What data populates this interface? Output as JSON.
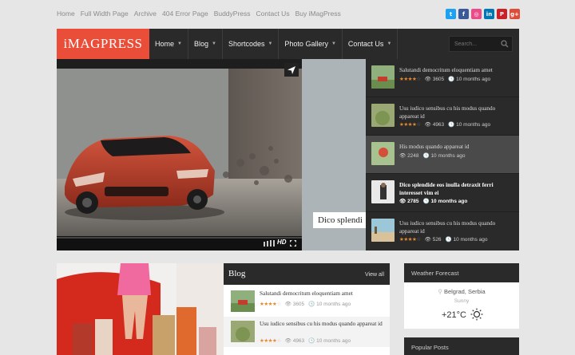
{
  "top_links": [
    "Home",
    "Full Width Page",
    "Archive",
    "404 Error Page",
    "BuddyPress",
    "Contact Us",
    "Buy iMagPress"
  ],
  "social": [
    {
      "name": "twitter",
      "glyph": "t",
      "color": "#1da1f2"
    },
    {
      "name": "facebook",
      "glyph": "f",
      "color": "#3b5998"
    },
    {
      "name": "dribbble",
      "glyph": "◎",
      "color": "#ea4c89"
    },
    {
      "name": "linkedin",
      "glyph": "in",
      "color": "#0077b5"
    },
    {
      "name": "pinterest",
      "glyph": "P",
      "color": "#cb2027"
    },
    {
      "name": "google-plus",
      "glyph": "g+",
      "color": "#dd4b39"
    }
  ],
  "brand": {
    "logo": "iMAGPRESS",
    "accent": "#ea4d38"
  },
  "nav": [
    {
      "label": "Home",
      "dropdown": true
    },
    {
      "label": "Blog",
      "dropdown": true
    },
    {
      "label": "Shortcodes",
      "dropdown": true
    },
    {
      "label": "Photo Gallery",
      "dropdown": true
    },
    {
      "label": "Contact Us",
      "dropdown": true
    }
  ],
  "search": {
    "placeholder": "Search..."
  },
  "slider": {
    "caption": "Dico splendi",
    "hd_label": "HD"
  },
  "slider_list": [
    {
      "title": "Salutandi democritum eloquentiam amet",
      "rating": 3.5,
      "views": "3605",
      "time": "10 months ago"
    },
    {
      "title": "Usu iudico sensibus cu his modus quando appareat id",
      "rating": 3.5,
      "views": "4963",
      "time": "10 months ago"
    },
    {
      "title": "His modus quando appareat id",
      "rating": 0,
      "views": "2248",
      "time": "10 months ago"
    },
    {
      "title": "Dico splendide eos inulla detraxit ferri interesset vim ei",
      "rating": 0,
      "views": "2785",
      "time": "10 months ago"
    },
    {
      "title": "Usu iudico sensibus cu his modus quando appareat id",
      "rating": 3.5,
      "views": "526",
      "time": "10 months ago"
    }
  ],
  "blog": {
    "title": "Blog",
    "view_all": "View all",
    "items": [
      {
        "title": "Salutandi democritum eloquentiam amet",
        "rating": 3.5,
        "views": "3605",
        "time": "10 months ago"
      },
      {
        "title": "Usu iudico sensibus cu his modus quando appareat id",
        "rating": 3.5,
        "views": "4963",
        "time": "10 months ago"
      }
    ]
  },
  "weather": {
    "title": "Weather Forecast",
    "location": "Belgrad, Serbia",
    "condition": "Sunny",
    "temperature": "+21°C"
  },
  "popular": {
    "title": "Popular Posts"
  }
}
